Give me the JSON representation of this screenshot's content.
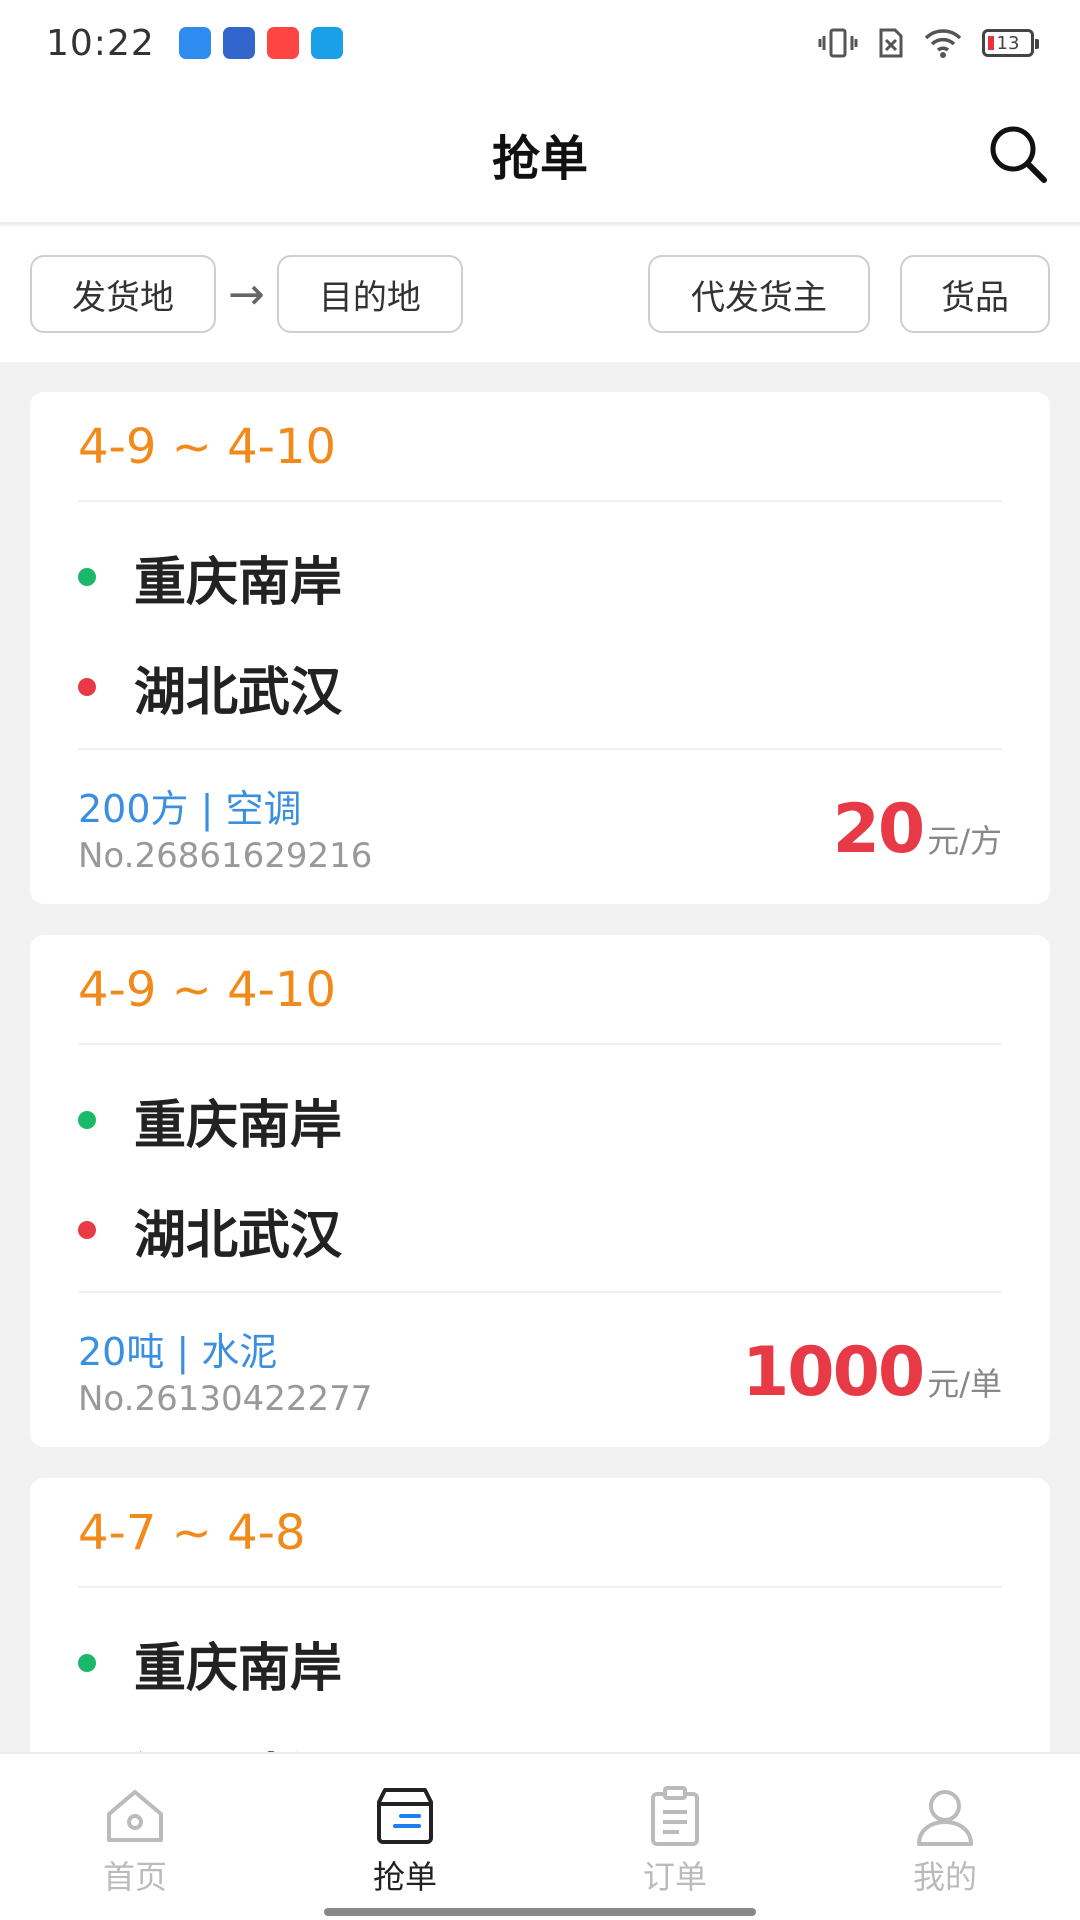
{
  "status": {
    "time": "10:22",
    "battery": "13"
  },
  "header": {
    "title": "抢单"
  },
  "filters": {
    "origin": "发货地",
    "arrow": "→",
    "destination": "目的地",
    "shipper": "代发货主",
    "goods": "货品"
  },
  "orders": [
    {
      "date": "4-9 ~ 4-10",
      "from": "重庆南岸",
      "to": "湖北武汉",
      "cargo": "200方 | 空调",
      "order_no": "No.26861629216",
      "price": "20",
      "unit": "元/方"
    },
    {
      "date": "4-9 ~ 4-10",
      "from": "重庆南岸",
      "to": "湖北武汉",
      "cargo": "20吨 | 水泥",
      "order_no": "No.26130422277",
      "price": "1000",
      "unit": "元/单"
    },
    {
      "date": "4-7 ~ 4-8",
      "from": "重庆南岸",
      "to": "湖北武汉",
      "cargo": "",
      "order_no": "",
      "price": "",
      "unit": ""
    }
  ],
  "tabs": [
    {
      "label": "首页",
      "icon": "home-icon"
    },
    {
      "label": "抢单",
      "icon": "grab-order-icon"
    },
    {
      "label": "订单",
      "icon": "clipboard-icon"
    },
    {
      "label": "我的",
      "icon": "user-icon"
    }
  ],
  "colors": {
    "accent_orange": "#f28a1b",
    "price_red": "#e83a46",
    "cargo_blue": "#3b8fe0",
    "origin_green": "#1bb86a",
    "dest_red": "#e83a46"
  }
}
